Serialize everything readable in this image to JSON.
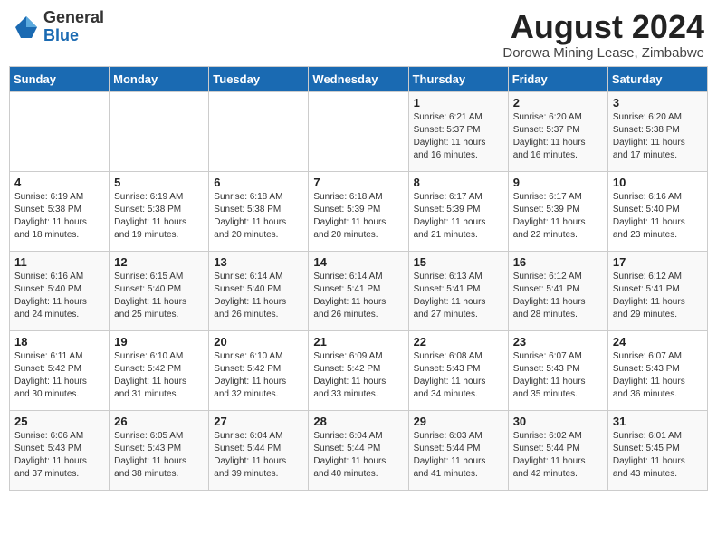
{
  "header": {
    "logo_general": "General",
    "logo_blue": "Blue",
    "month_title": "August 2024",
    "location": "Dorowa Mining Lease, Zimbabwe"
  },
  "weekdays": [
    "Sunday",
    "Monday",
    "Tuesday",
    "Wednesday",
    "Thursday",
    "Friday",
    "Saturday"
  ],
  "weeks": [
    [
      {
        "day": "",
        "info": ""
      },
      {
        "day": "",
        "info": ""
      },
      {
        "day": "",
        "info": ""
      },
      {
        "day": "",
        "info": ""
      },
      {
        "day": "1",
        "info": "Sunrise: 6:21 AM\nSunset: 5:37 PM\nDaylight: 11 hours\nand 16 minutes."
      },
      {
        "day": "2",
        "info": "Sunrise: 6:20 AM\nSunset: 5:37 PM\nDaylight: 11 hours\nand 16 minutes."
      },
      {
        "day": "3",
        "info": "Sunrise: 6:20 AM\nSunset: 5:38 PM\nDaylight: 11 hours\nand 17 minutes."
      }
    ],
    [
      {
        "day": "4",
        "info": "Sunrise: 6:19 AM\nSunset: 5:38 PM\nDaylight: 11 hours\nand 18 minutes."
      },
      {
        "day": "5",
        "info": "Sunrise: 6:19 AM\nSunset: 5:38 PM\nDaylight: 11 hours\nand 19 minutes."
      },
      {
        "day": "6",
        "info": "Sunrise: 6:18 AM\nSunset: 5:38 PM\nDaylight: 11 hours\nand 20 minutes."
      },
      {
        "day": "7",
        "info": "Sunrise: 6:18 AM\nSunset: 5:39 PM\nDaylight: 11 hours\nand 20 minutes."
      },
      {
        "day": "8",
        "info": "Sunrise: 6:17 AM\nSunset: 5:39 PM\nDaylight: 11 hours\nand 21 minutes."
      },
      {
        "day": "9",
        "info": "Sunrise: 6:17 AM\nSunset: 5:39 PM\nDaylight: 11 hours\nand 22 minutes."
      },
      {
        "day": "10",
        "info": "Sunrise: 6:16 AM\nSunset: 5:40 PM\nDaylight: 11 hours\nand 23 minutes."
      }
    ],
    [
      {
        "day": "11",
        "info": "Sunrise: 6:16 AM\nSunset: 5:40 PM\nDaylight: 11 hours\nand 24 minutes."
      },
      {
        "day": "12",
        "info": "Sunrise: 6:15 AM\nSunset: 5:40 PM\nDaylight: 11 hours\nand 25 minutes."
      },
      {
        "day": "13",
        "info": "Sunrise: 6:14 AM\nSunset: 5:40 PM\nDaylight: 11 hours\nand 26 minutes."
      },
      {
        "day": "14",
        "info": "Sunrise: 6:14 AM\nSunset: 5:41 PM\nDaylight: 11 hours\nand 26 minutes."
      },
      {
        "day": "15",
        "info": "Sunrise: 6:13 AM\nSunset: 5:41 PM\nDaylight: 11 hours\nand 27 minutes."
      },
      {
        "day": "16",
        "info": "Sunrise: 6:12 AM\nSunset: 5:41 PM\nDaylight: 11 hours\nand 28 minutes."
      },
      {
        "day": "17",
        "info": "Sunrise: 6:12 AM\nSunset: 5:41 PM\nDaylight: 11 hours\nand 29 minutes."
      }
    ],
    [
      {
        "day": "18",
        "info": "Sunrise: 6:11 AM\nSunset: 5:42 PM\nDaylight: 11 hours\nand 30 minutes."
      },
      {
        "day": "19",
        "info": "Sunrise: 6:10 AM\nSunset: 5:42 PM\nDaylight: 11 hours\nand 31 minutes."
      },
      {
        "day": "20",
        "info": "Sunrise: 6:10 AM\nSunset: 5:42 PM\nDaylight: 11 hours\nand 32 minutes."
      },
      {
        "day": "21",
        "info": "Sunrise: 6:09 AM\nSunset: 5:42 PM\nDaylight: 11 hours\nand 33 minutes."
      },
      {
        "day": "22",
        "info": "Sunrise: 6:08 AM\nSunset: 5:43 PM\nDaylight: 11 hours\nand 34 minutes."
      },
      {
        "day": "23",
        "info": "Sunrise: 6:07 AM\nSunset: 5:43 PM\nDaylight: 11 hours\nand 35 minutes."
      },
      {
        "day": "24",
        "info": "Sunrise: 6:07 AM\nSunset: 5:43 PM\nDaylight: 11 hours\nand 36 minutes."
      }
    ],
    [
      {
        "day": "25",
        "info": "Sunrise: 6:06 AM\nSunset: 5:43 PM\nDaylight: 11 hours\nand 37 minutes."
      },
      {
        "day": "26",
        "info": "Sunrise: 6:05 AM\nSunset: 5:43 PM\nDaylight: 11 hours\nand 38 minutes."
      },
      {
        "day": "27",
        "info": "Sunrise: 6:04 AM\nSunset: 5:44 PM\nDaylight: 11 hours\nand 39 minutes."
      },
      {
        "day": "28",
        "info": "Sunrise: 6:04 AM\nSunset: 5:44 PM\nDaylight: 11 hours\nand 40 minutes."
      },
      {
        "day": "29",
        "info": "Sunrise: 6:03 AM\nSunset: 5:44 PM\nDaylight: 11 hours\nand 41 minutes."
      },
      {
        "day": "30",
        "info": "Sunrise: 6:02 AM\nSunset: 5:44 PM\nDaylight: 11 hours\nand 42 minutes."
      },
      {
        "day": "31",
        "info": "Sunrise: 6:01 AM\nSunset: 5:45 PM\nDaylight: 11 hours\nand 43 minutes."
      }
    ]
  ]
}
